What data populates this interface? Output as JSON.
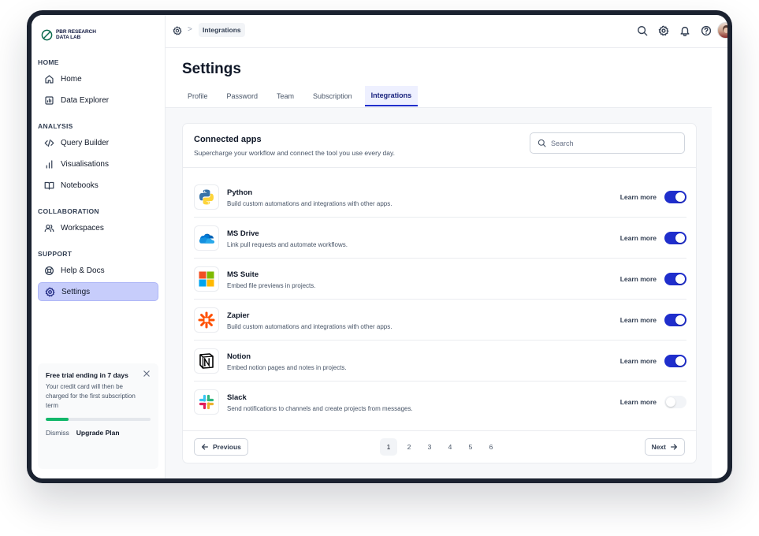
{
  "brand": {
    "name_line1": "PBR RESEARCH",
    "name_line2": "DATA LAB"
  },
  "sidebar": {
    "sections": [
      {
        "title": "HOME",
        "items": [
          {
            "label": "Home",
            "icon": "home-icon"
          },
          {
            "label": "Data Explorer",
            "icon": "data-explorer-icon"
          }
        ]
      },
      {
        "title": "ANALYSIS",
        "items": [
          {
            "label": "Query Builder",
            "icon": "code-icon"
          },
          {
            "label": "Visualisations",
            "icon": "bar-chart-icon"
          },
          {
            "label": "Notebooks",
            "icon": "book-icon"
          }
        ]
      },
      {
        "title": "COLLABORATION",
        "items": [
          {
            "label": "Workspaces",
            "icon": "users-icon"
          }
        ]
      },
      {
        "title": "SUPPORT",
        "items": [
          {
            "label": "Help & Docs",
            "icon": "lifebuoy-icon"
          },
          {
            "label": "Settings",
            "icon": "gear-icon",
            "active": true
          }
        ]
      }
    ],
    "trial": {
      "title": "Free trial ending in 7 days",
      "text": "Your credit card will then be charged for the first subscription term",
      "progress": 0.22,
      "dismiss": "Dismiss",
      "upgrade": "Upgrade Plan"
    }
  },
  "breadcrumb": {
    "current": "Integrations",
    "separator": ">"
  },
  "page": {
    "title": "Settings",
    "tabs": [
      {
        "label": "Profile"
      },
      {
        "label": "Password"
      },
      {
        "label": "Team"
      },
      {
        "label": "Subscription"
      },
      {
        "label": "Integrations",
        "active": true
      }
    ]
  },
  "connected": {
    "title": "Connected apps",
    "subtitle": "Supercharge your workflow and connect the tool you use every day.",
    "search_placeholder": "Search",
    "learn_more": "Learn more",
    "apps": [
      {
        "name": "Python",
        "desc": "Build custom automations and integrations with other apps.",
        "enabled": true,
        "icon": "python-icon"
      },
      {
        "name": "MS Drive",
        "desc": "Link pull requests and automate workflows.",
        "enabled": true,
        "icon": "ms-drive-icon"
      },
      {
        "name": "MS Suite",
        "desc": "Embed file previews in projects.",
        "enabled": true,
        "icon": "ms-suite-icon"
      },
      {
        "name": "Zapier",
        "desc": "Build custom automations and integrations with other apps.",
        "enabled": true,
        "icon": "zapier-icon"
      },
      {
        "name": "Notion",
        "desc": "Embed notion pages and notes in projects.",
        "enabled": true,
        "icon": "notion-icon"
      },
      {
        "name": "Slack",
        "desc": "Send notifications to channels and create projects from messages.",
        "enabled": false,
        "icon": "slack-icon"
      }
    ]
  },
  "pagination": {
    "previous": "Previous",
    "next": "Next",
    "pages": [
      "1",
      "2",
      "3",
      "4",
      "5",
      "6"
    ],
    "current": "1"
  },
  "colors": {
    "accent": "#1f2ecc",
    "active_nav": "#c7cdfb",
    "progress": "#12b76a"
  }
}
